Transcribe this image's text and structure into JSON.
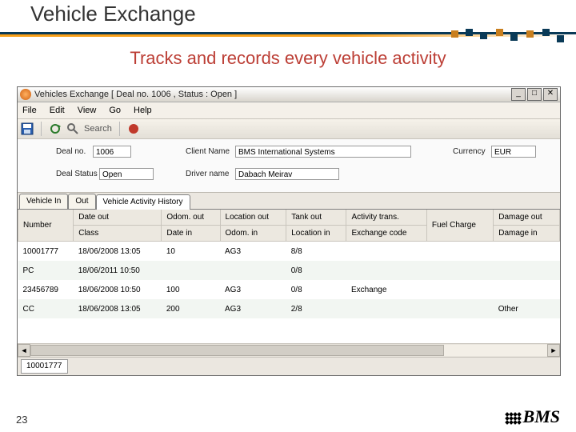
{
  "slide": {
    "title": "Vehicle Exchange",
    "subtitle": "Tracks and records every vehicle activity",
    "page_number": "23",
    "logo_text": "BMS"
  },
  "window": {
    "title": "Vehicles Exchange [ Deal no. 1006 ,   Status : Open ]",
    "menus": {
      "file": "File",
      "edit": "Edit",
      "view": "View",
      "go": "Go",
      "help": "Help"
    },
    "toolbar": {
      "search_label": "Search"
    },
    "form": {
      "deal_no_label": "Deal no.",
      "deal_no": "1006",
      "deal_status_label": "Deal Status",
      "deal_status": "Open",
      "client_name_label": "Client Name",
      "client_name": "BMS International Systems",
      "driver_name_label": "Driver name",
      "driver_name": "Dabach Meirav",
      "currency_label": "Currency",
      "currency": "EUR"
    },
    "tabs": {
      "in": "Vehicle In",
      "out": "Out",
      "history": "Vehicle Activity History"
    },
    "grid": {
      "headers": {
        "number": "Number",
        "date_out": "Date out",
        "odom_out": "Odom. out",
        "location_out": "Location out",
        "tank_out": "Tank out",
        "activity_trans": "Activity trans.",
        "fuel_charge": "Fuel Charge",
        "damage_out": "Damage out",
        "class": "Class",
        "date_in": "Date in",
        "odom_in": "Odom. in",
        "location_in": "Location in",
        "exchange_code": "Exchange code",
        "damage_in": "Damage in"
      },
      "rows": [
        {
          "number": "10001777",
          "date_out": "18/06/2008 13:05",
          "odom_out": "10",
          "location_out": "AG3",
          "tank_out": "8/8",
          "activity_trans": "",
          "fuel_charge": "",
          "damage_out": "",
          "class": "PC",
          "date_in": "18/06/2011 10:50",
          "odom_in": "",
          "location_in": "",
          "exchange_code": "0/8",
          "damage_in": ""
        },
        {
          "number": "23456789",
          "date_out": "18/06/2008 10:50",
          "odom_out": "100",
          "location_out": "AG3",
          "tank_out": "0/8",
          "activity_trans": "Exchange",
          "fuel_charge": "",
          "damage_out": "",
          "class": "CC",
          "date_in": "18/06/2008 13:05",
          "odom_in": "200",
          "location_in": "AG3",
          "exchange_code": "2/8",
          "damage_in": "Other"
        }
      ]
    },
    "footer": {
      "value": "10001777"
    }
  }
}
